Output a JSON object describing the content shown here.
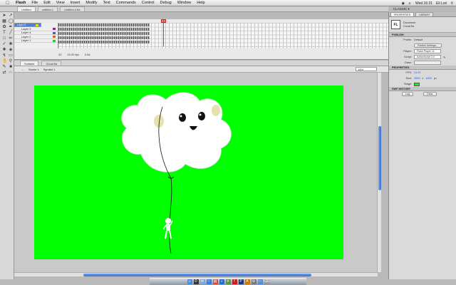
{
  "menubar": {
    "app": "Flash",
    "items": [
      "File",
      "Edit",
      "View",
      "Insert",
      "Modify",
      "Text",
      "Commands",
      "Control",
      "Debug",
      "Window",
      "Help"
    ],
    "clock": "Wed 16:31",
    "user": "Eli Lori"
  },
  "doc_tabs": [
    "Untitled",
    "untitled-1",
    "Untitled-4.fla"
  ],
  "workspace_mode": "CLASSIC ▾",
  "layers": [
    {
      "name": "Layer 5",
      "color": "#f0e000"
    },
    {
      "name": "Layer 3",
      "color": "#c000c0"
    },
    {
      "name": "Layer 4",
      "color": "#3060e0"
    },
    {
      "name": "Layer 2",
      "color": "#e06020"
    },
    {
      "name": "Layer 1",
      "color": "#30c030"
    }
  ],
  "timeline_status": {
    "frame": "20",
    "fps": "24.00 fps",
    "time": "0.8s"
  },
  "scene": {
    "tab1": "Solitaire",
    "tab2": "Cloud.fla",
    "scene_label": "Scene 1",
    "symbol_label": "Symbol 1"
  },
  "zoom": "14%",
  "panel": {
    "tabs": [
      "PROPERTIES",
      "LIBRARY"
    ],
    "doc_type": "Document",
    "doc_name": "Cloud.fla",
    "fl_icon": "FL",
    "publish_header": "PUBLISH",
    "profile_label": "Profile:",
    "profile_value": "Default",
    "publish_settings": "Publish Settings...",
    "player_label": "Player:",
    "player_value": "Flash Player 11",
    "script_label": "Script:",
    "script_value": "ActionScript 3.0",
    "class_label": "Class:",
    "properties_header": "PROPERTIES",
    "fps_label": "FPS:",
    "fps_value": "24.00",
    "size_label": "Size:",
    "size_w": "3500",
    "size_x": "x",
    "size_h": "1800",
    "size_unit": "px",
    "stage_label": "Stage:",
    "swf_header": "SWF HISTORY",
    "log_button": "Log",
    "clear_button": "Clear"
  },
  "colors": {
    "stage": "#00ff00",
    "selection": "#4d80d6",
    "playhead": "#e0302a"
  }
}
